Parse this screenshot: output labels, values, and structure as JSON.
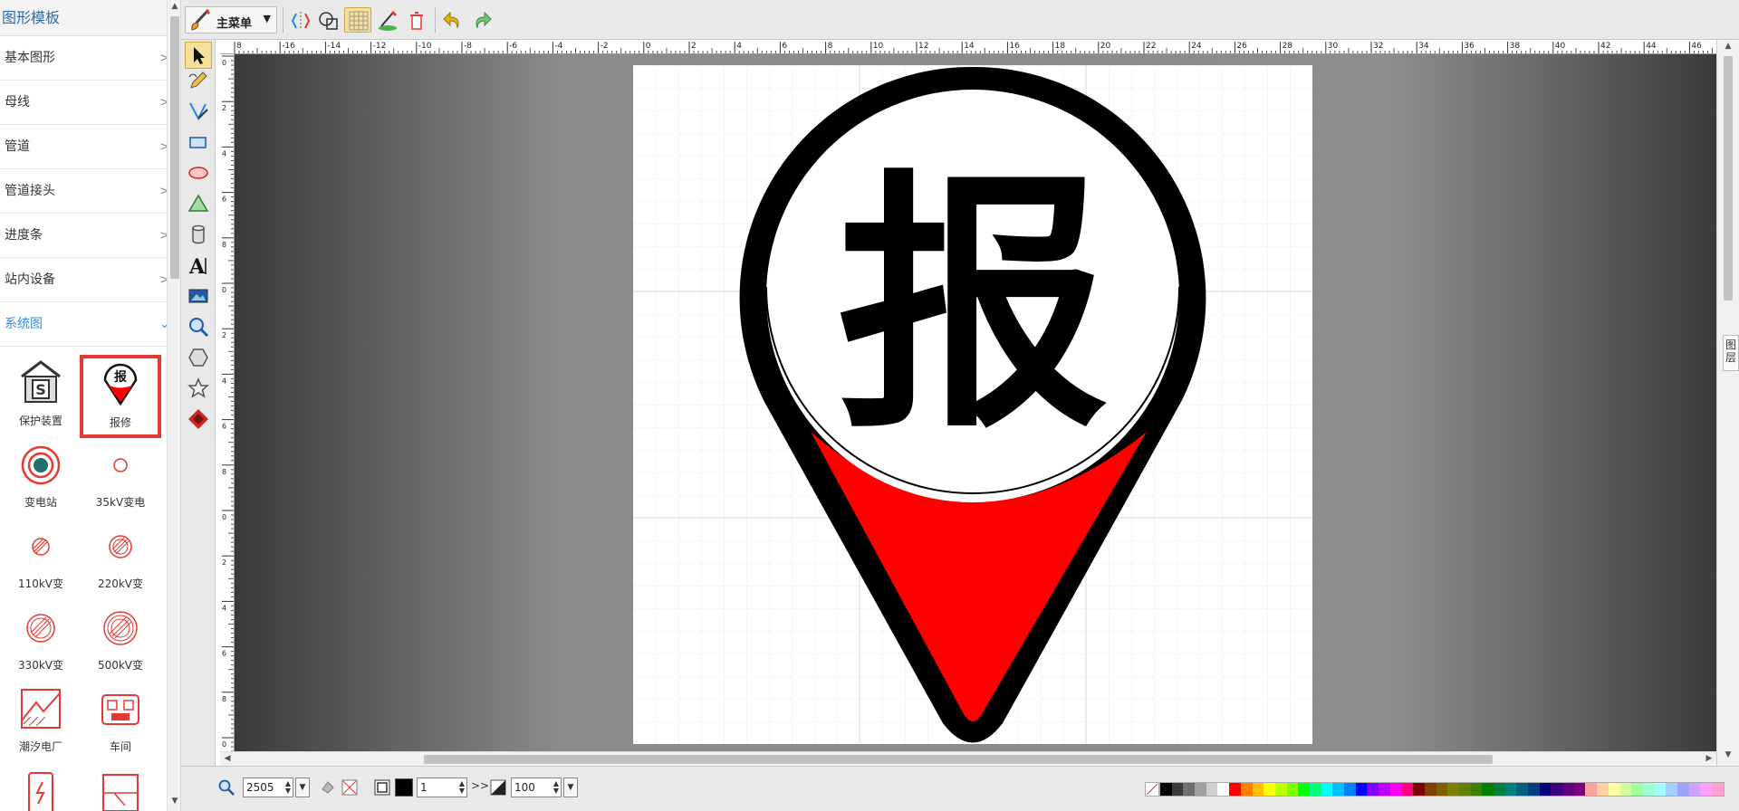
{
  "panel": {
    "title": "图形模板",
    "categories": [
      {
        "label": "基本图形",
        "chevron": ">"
      },
      {
        "label": "母线",
        "chevron": ">"
      },
      {
        "label": "管道",
        "chevron": ">"
      },
      {
        "label": "管道接头",
        "chevron": ">"
      },
      {
        "label": "进度条",
        "chevron": ">"
      },
      {
        "label": "站内设备",
        "chevron": ">"
      },
      {
        "label": "系统图",
        "chevron": "⌄"
      }
    ],
    "shapes": [
      {
        "label": "保护装置",
        "icon": "protection-device-icon"
      },
      {
        "label": "报修",
        "icon": "repair-pin-icon",
        "selected": true
      },
      {
        "label": "变电站",
        "icon": "substation-icon"
      },
      {
        "label": "35kV变电",
        "icon": "35kv-substation-icon"
      },
      {
        "label": "110kV变",
        "icon": "110kv-substation-icon"
      },
      {
        "label": "220kV变",
        "icon": "220kv-substation-icon"
      },
      {
        "label": "330kV变",
        "icon": "330kv-substation-icon"
      },
      {
        "label": "500kV变",
        "icon": "500kv-substation-icon"
      },
      {
        "label": "潮汐电厂",
        "icon": "tidal-plant-icon"
      },
      {
        "label": "车间",
        "icon": "workshop-icon"
      },
      {
        "label": "",
        "icon": "power-plant-icon"
      },
      {
        "label": "",
        "icon": "factory-icon"
      }
    ]
  },
  "toolbar": {
    "main_menu_label": "主菜单",
    "icons": [
      "paint-brush-icon",
      "flip-icon",
      "shape-combine-icon",
      "grid-toggle-icon",
      "anchor-edit-icon",
      "delete-icon",
      "undo-icon",
      "redo-icon"
    ]
  },
  "tools": [
    "pointer-icon",
    "pencil-icon",
    "pen-icon",
    "rectangle-icon",
    "ellipse-icon",
    "triangle-icon",
    "cylinder-icon",
    "text-icon",
    "image-icon",
    "zoom-icon",
    "hexagon-icon",
    "star-icon",
    "compass-icon"
  ],
  "ruler": {
    "h_labels": [
      "8",
      "-16",
      "-14",
      "-12",
      "-10",
      "-8",
      "-6",
      "-4",
      "-2",
      "0",
      "2",
      "4",
      "6",
      "8",
      "10",
      "12",
      "14",
      "16",
      "18",
      "20",
      "22",
      "24",
      "26",
      "28",
      "30",
      "32",
      "34",
      "36",
      "38",
      "40",
      "42",
      "44",
      "46"
    ],
    "v_labels": [
      "0",
      "2",
      "4",
      "6",
      "8",
      "0",
      "2",
      "4",
      "6",
      "8",
      "0",
      "2",
      "4",
      "6",
      "8",
      "0"
    ]
  },
  "canvas": {
    "glyph": "报",
    "colors": {
      "outline": "#000000",
      "fill_bottom": "#ff0000",
      "paper": "#ffffff",
      "grid": "#e3e3e3"
    }
  },
  "layer_tab": {
    "label": "图层"
  },
  "bottom": {
    "zoom_value": "2505",
    "line_width": "1",
    "arrow_label": ">>",
    "opacity": "100",
    "palette": [
      "#000000",
      "#3a3a3a",
      "#707070",
      "#a0a0a0",
      "#d0d0d0",
      "#ffffff",
      "#ff0000",
      "#ff7f00",
      "#ffbf00",
      "#ffff00",
      "#bfff00",
      "#7fff00",
      "#00ff00",
      "#00ff7f",
      "#00ffff",
      "#00bfff",
      "#007fff",
      "#0000ff",
      "#7f00ff",
      "#bf00ff",
      "#ff00ff",
      "#ff007f",
      "#7f0000",
      "#7f3f00",
      "#7f5f00",
      "#7f7f00",
      "#5f7f00",
      "#3f7f00",
      "#007f00",
      "#007f3f",
      "#007f7f",
      "#005f7f",
      "#003f7f",
      "#00007f",
      "#3f007f",
      "#5f007f",
      "#7f007f",
      "#ffa0a0",
      "#ffd0a0",
      "#ffffa0",
      "#d0ffa0",
      "#a0ffa0",
      "#a0ffd0",
      "#a0ffff",
      "#a0d0ff",
      "#a0a0ff",
      "#d0a0ff",
      "#ffa0ff",
      "#ffa0d0"
    ]
  }
}
